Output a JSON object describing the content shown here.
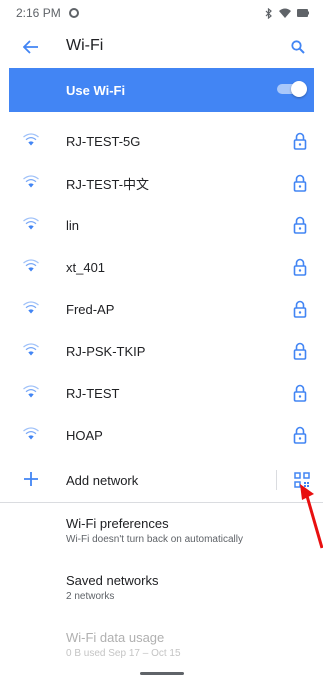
{
  "status_bar": {
    "time": "2:16 PM",
    "icons": [
      "notification-icon",
      "bluetooth-icon",
      "wifi-signal-icon",
      "battery-icon"
    ]
  },
  "app_bar": {
    "title": "Wi-Fi",
    "back_icon": "arrow-back-icon",
    "search_icon": "search-icon"
  },
  "master_switch": {
    "label": "Use Wi-Fi",
    "state": "on"
  },
  "networks": [
    {
      "ssid": "RJ-TEST-5G",
      "secured": true
    },
    {
      "ssid": "RJ-TEST-中文",
      "secured": true
    },
    {
      "ssid": "lin",
      "secured": true
    },
    {
      "ssid": "xt_401",
      "secured": true
    },
    {
      "ssid": "Fred-AP",
      "secured": true
    },
    {
      "ssid": "RJ-PSK-TKIP",
      "secured": true
    },
    {
      "ssid": "RJ-TEST",
      "secured": true
    },
    {
      "ssid": "HOAP",
      "secured": true
    }
  ],
  "add_network": {
    "label": "Add network",
    "scan_icon": "qr-code-scanner-icon"
  },
  "preferences": {
    "wifi_preferences": {
      "title": "Wi-Fi preferences",
      "summary": "Wi-Fi doesn't turn back on automatically"
    },
    "saved_networks": {
      "title": "Saved networks",
      "summary": "2 networks"
    },
    "data_usage": {
      "title": "Wi-Fi data usage",
      "summary": "0 B used Sep 17 – Oct 15"
    }
  },
  "colors": {
    "accent": "#4285f4",
    "annotation_arrow": "#e81010"
  }
}
